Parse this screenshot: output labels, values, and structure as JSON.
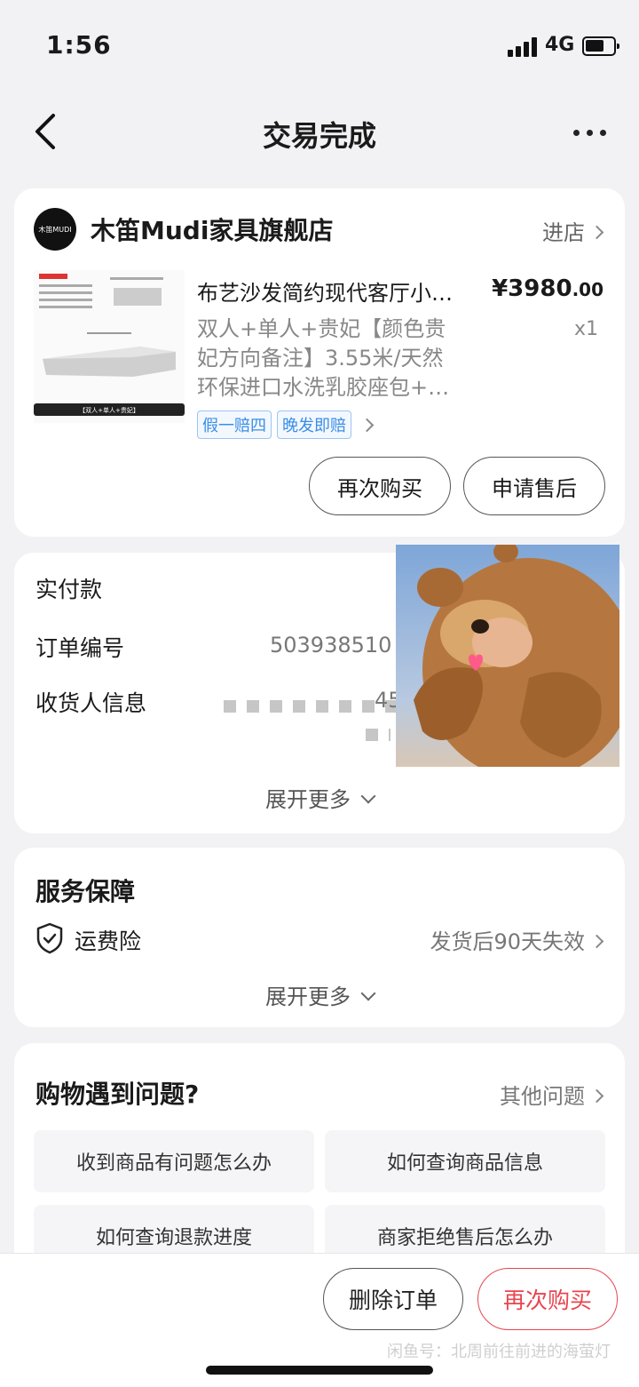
{
  "status_bar": {
    "time": "1:56",
    "network": "4G"
  },
  "nav": {
    "title": "交易完成"
  },
  "shop": {
    "logo_text": "木笛MUDI",
    "name": "木笛Mudi家具旗舰店",
    "enter_label": "进店"
  },
  "product": {
    "title": "布艺沙发简约现代客厅小户型",
    "price_main": "¥3980",
    "price_decimal": ".00",
    "spec_lines": [
      "双人+单人+贵妃【颜色贵",
      "妃方向备注】3.55米/天然",
      "环保进口水洗乳胶座包+…"
    ],
    "quantity": "x1",
    "tags": [
      "假一赔四",
      "晚发即赔"
    ],
    "image_caption": "【双人+单人+贵妃】"
  },
  "order_actions": {
    "rebuy": "再次购买",
    "after_sale": "申请售后"
  },
  "order_info": {
    "paid_label": "实付款",
    "order_no_label": "订单编号",
    "order_no_value": "503938510",
    "receiver_label": "收货人信息",
    "receiver_partial": "45",
    "expand": "展开更多"
  },
  "service": {
    "title": "服务保障",
    "item_label": "运费险",
    "item_value": "发货后90天失效",
    "expand": "展开更多"
  },
  "help": {
    "title": "购物遇到问题?",
    "other": "其他问题",
    "questions": [
      "收到商品有问题怎么办",
      "如何查询商品信息",
      "如何查询退款进度",
      "商家拒绝售后怎么办"
    ]
  },
  "bottom": {
    "delete": "删除订单",
    "rebuy": "再次购买",
    "watermark": "闲鱼号：北周前往前进的海萤灯"
  },
  "colors": {
    "accent_red": "#e8454f",
    "tag_blue": "#3a8ee6",
    "page_bg": "#f2f2f4"
  }
}
